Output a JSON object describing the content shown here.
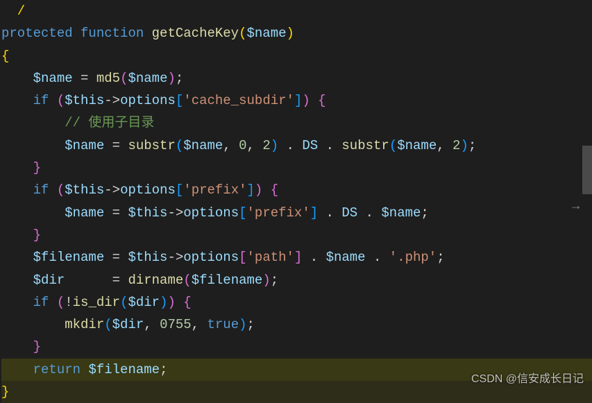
{
  "code": {
    "line0": "  /",
    "protected": "protected",
    "function": "function",
    "funcName": "getCacheKey",
    "paramName": "$name",
    "openBrace": "{",
    "closeBrace": "}",
    "var_name": "$name",
    "var_this": "$this",
    "var_filename": "$filename",
    "var_dir": "$dir",
    "md5": "md5",
    "if": "if",
    "return": "return",
    "options": "options",
    "substr": "substr",
    "dirname": "dirname",
    "is_dir": "is_dir",
    "mkdir": "mkdir",
    "true": "true",
    "DS": "DS",
    "str_cache_subdir": "'cache_subdir'",
    "str_prefix": "'prefix'",
    "str_path": "'path'",
    "str_php": "'.php'",
    "comment_subdir": "// 使用子目录",
    "num_0": "0",
    "num_2": "2",
    "num_0755": "0755",
    "eq": " = ",
    "arrow": "->",
    "semi": ";",
    "comma": ", ",
    "dot": " . ",
    "excl": "!",
    "lparen": "(",
    "rparen": ")",
    "lbracket": "[",
    "rbracket": "]",
    "space": " "
  },
  "watermark": "CSDN @信安成长日记",
  "scroll_arrow": "→"
}
